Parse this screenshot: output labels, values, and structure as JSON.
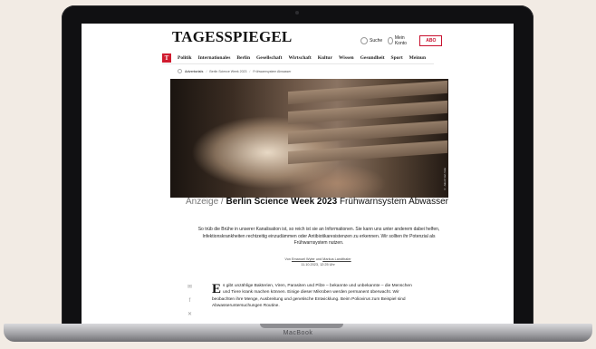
{
  "device": {
    "base_label": "MacBook"
  },
  "site": {
    "logo": "TAGESSPIEGEL",
    "search_label": "Suche",
    "account_label": "Mein Konto",
    "abo_label": "ABO"
  },
  "nav": {
    "badge": "T",
    "items": [
      "Politik",
      "Internationales",
      "Berlin",
      "Gesellschaft",
      "Wirtschaft",
      "Kultur",
      "Wissen",
      "Gesundheit",
      "Sport",
      "Meinun"
    ]
  },
  "breadcrumb": {
    "items": [
      "Advertorials",
      "Berlin Science Week 2023",
      "Frühwarnsystem Abwasser"
    ]
  },
  "hero": {
    "credit": "© Jakob Van Vole"
  },
  "article": {
    "kicker": "Anzeige",
    "kicker_sep": "/",
    "highlight": "Berlin Science Week 2023",
    "title": "Frühwarnsystem Abwasser",
    "lead": "So trüb die Brühe in unserer Kanalisation ist, so reich ist sie an Informationen. Sie kann uns unter anderem dabei helfen, Infektionskrankheiten rechtzeitig einzudämmen oder Antibiotikaresistenzen zu erkennen. Wir sollten ihr Potenzial als Frühwarnsystem nutzen.",
    "byline_prefix": "Von",
    "author1": "Emanuel Wyler",
    "byline_and": "und",
    "author2": "Markus Landthaler",
    "date": "11.10.2023, 12:25 Uhr",
    "dropcap": "E",
    "body": "s gibt unzählige Bakterien, Viren, Parasiten und Pilze – bekannte und unbekannte – die Menschen und Tiere krank machen können. Einige dieser Mikroben werden permanent überwacht. Wir beobachten ihre Menge, Ausbreitung und genetische Entwicklung. Beim Poliovirus zum Beispiel sind Abwasseruntersuchungen Routine."
  }
}
